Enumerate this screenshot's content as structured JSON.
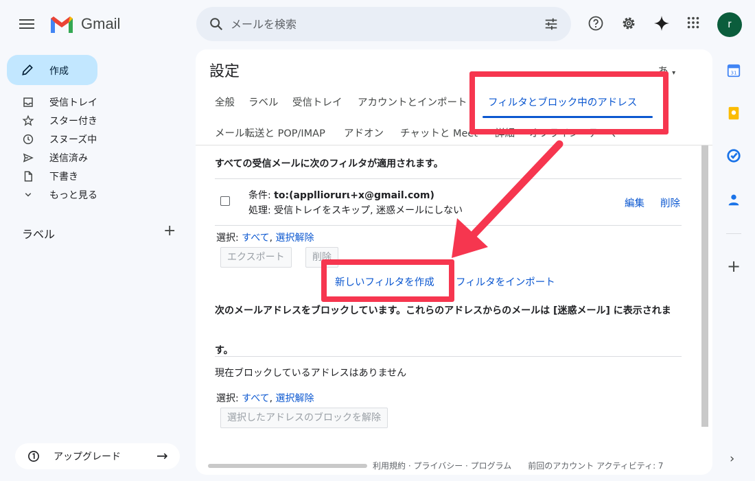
{
  "app": {
    "brand": "Gmail",
    "avatar_letter": "r"
  },
  "search": {
    "placeholder": "メールを検索"
  },
  "sidebar": {
    "compose_label": "作成",
    "items": [
      {
        "label": "受信トレイ"
      },
      {
        "label": "スター付き"
      },
      {
        "label": "スヌーズ中"
      },
      {
        "label": "送信済み"
      },
      {
        "label": "下書き"
      },
      {
        "label": "もっと見る"
      }
    ],
    "labels_heading": "ラベル",
    "upgrade_label": "アップグレード"
  },
  "settings": {
    "title": "設定",
    "lang_indicator": "あ",
    "tabs_row1": [
      "全般",
      "ラベル",
      "受信トレイ",
      "アカウントとインポート",
      "フィルタとブロック中のアドレス"
    ],
    "tabs_row2": [
      "メール転送と POP/IMAP",
      "アドオン",
      "チャットと Meet",
      "詳細",
      "オフライン",
      "テーマ"
    ],
    "active_tab": "フィルタとブロック中のアドレス"
  },
  "filters": {
    "heading": "すべての受信メールに次のフィルタが適用されます。",
    "rows": [
      {
        "condition_label": "条件: ",
        "condition_value": "to:(applliorurι+x@gmail.com)",
        "action_label": "処理: ",
        "action_value": "受信トレイをスキップ, 迷惑メールにしない",
        "edit": "編集",
        "delete": "削除"
      }
    ],
    "select_label": "選択: ",
    "select_all": "すべて",
    "select_none": "選択解除",
    "export_button": "エクスポート",
    "delete_button": "削除",
    "new_filter_link": "新しいフィルタを作成",
    "import_filter_link": "フィルタをインポート"
  },
  "blocked": {
    "heading": "次のメールアドレスをブロックしています。これらのアドレスからのメールは [迷惑メール] に表示されます。",
    "empty_text": "現在ブロックしているアドレスはありません",
    "select_label": "選択: ",
    "select_all": "すべて",
    "select_none": "選択解除",
    "unblock_button": "選択したアドレスのブロックを解除"
  },
  "footer": {
    "text": "利用規約 · プライバシー · プログラム　　前回のアカウント アクティビティ: 7"
  },
  "colors": {
    "accent": "#0b57d0",
    "highlight": "#f6364f",
    "compose_bg": "#c2e7ff",
    "avatar_bg": "#0b5d3c"
  }
}
